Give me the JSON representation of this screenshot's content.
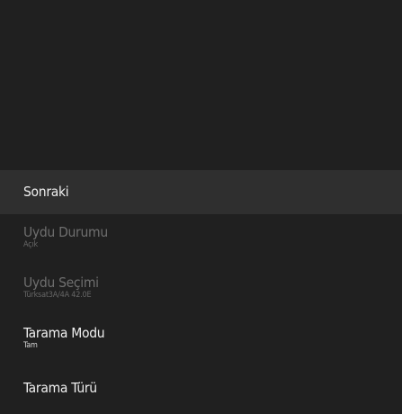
{
  "menu": {
    "items": [
      {
        "label": "Sonraki",
        "value": ""
      },
      {
        "label": "Uydu Durumu",
        "value": "Açık"
      },
      {
        "label": "Uydu Seçimi",
        "value": "Türksat3A/4A 42.0E"
      },
      {
        "label": "Tarama Modu",
        "value": "Tam"
      },
      {
        "label": "Tarama Türü",
        "value": ""
      }
    ]
  },
  "colors": {
    "background": "#202020",
    "selected_row": "#2f2f2f",
    "enabled_text": "#efefef",
    "disabled_text": "#6f6f6f"
  }
}
